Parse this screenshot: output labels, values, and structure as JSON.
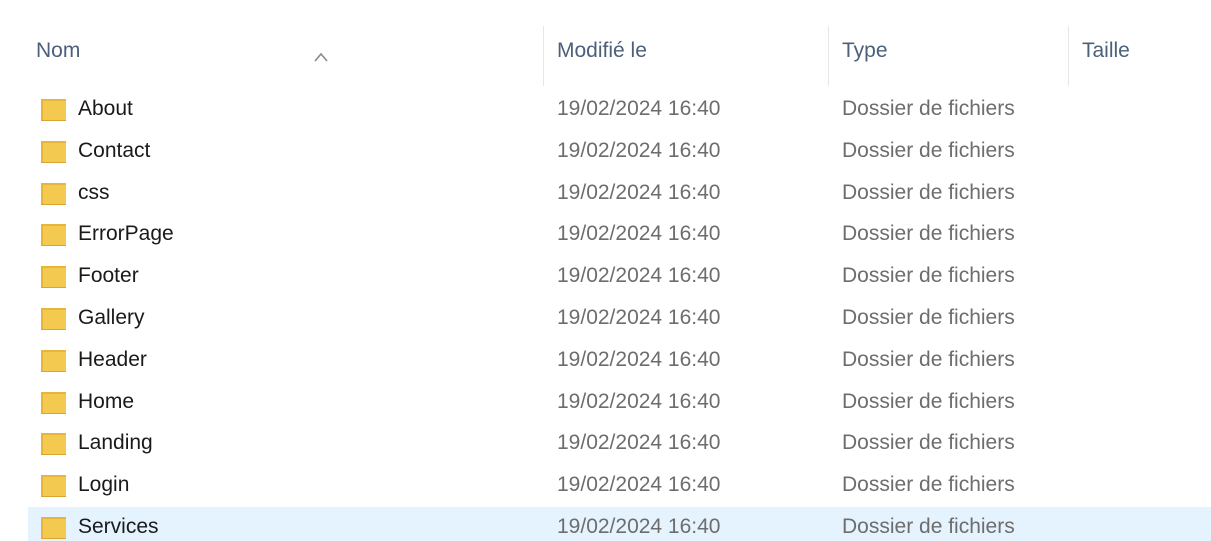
{
  "columns": {
    "name": "Nom",
    "modified": "Modifié le",
    "type": "Type",
    "size": "Taille"
  },
  "sort": {
    "column": "name",
    "direction": "ascending",
    "icon": "chevron-up-icon"
  },
  "colors": {
    "header_text": "#4c607a",
    "name_text": "#1a1a1a",
    "meta_text": "#6d6d6d",
    "selection": "#e5f3ff",
    "folder": "#f3c94f"
  },
  "rows": [
    {
      "name": "About",
      "modified": "19/02/2024 16:40",
      "type": "Dossier de fichiers",
      "size": "",
      "icon": "folder-icon"
    },
    {
      "name": "Contact",
      "modified": "19/02/2024 16:40",
      "type": "Dossier de fichiers",
      "size": "",
      "icon": "folder-icon"
    },
    {
      "name": "css",
      "modified": "19/02/2024 16:40",
      "type": "Dossier de fichiers",
      "size": "",
      "icon": "folder-icon"
    },
    {
      "name": "ErrorPage",
      "modified": "19/02/2024 16:40",
      "type": "Dossier de fichiers",
      "size": "",
      "icon": "folder-icon"
    },
    {
      "name": "Footer",
      "modified": "19/02/2024 16:40",
      "type": "Dossier de fichiers",
      "size": "",
      "icon": "folder-icon"
    },
    {
      "name": "Gallery",
      "modified": "19/02/2024 16:40",
      "type": "Dossier de fichiers",
      "size": "",
      "icon": "folder-icon"
    },
    {
      "name": "Header",
      "modified": "19/02/2024 16:40",
      "type": "Dossier de fichiers",
      "size": "",
      "icon": "folder-icon"
    },
    {
      "name": "Home",
      "modified": "19/02/2024 16:40",
      "type": "Dossier de fichiers",
      "size": "",
      "icon": "folder-icon"
    },
    {
      "name": "Landing",
      "modified": "19/02/2024 16:40",
      "type": "Dossier de fichiers",
      "size": "",
      "icon": "folder-icon"
    },
    {
      "name": "Login",
      "modified": "19/02/2024 16:40",
      "type": "Dossier de fichiers",
      "size": "",
      "icon": "folder-icon"
    },
    {
      "name": "Services",
      "modified": "19/02/2024 16:40",
      "type": "Dossier de fichiers",
      "size": "",
      "icon": "folder-icon",
      "selected": true
    }
  ]
}
